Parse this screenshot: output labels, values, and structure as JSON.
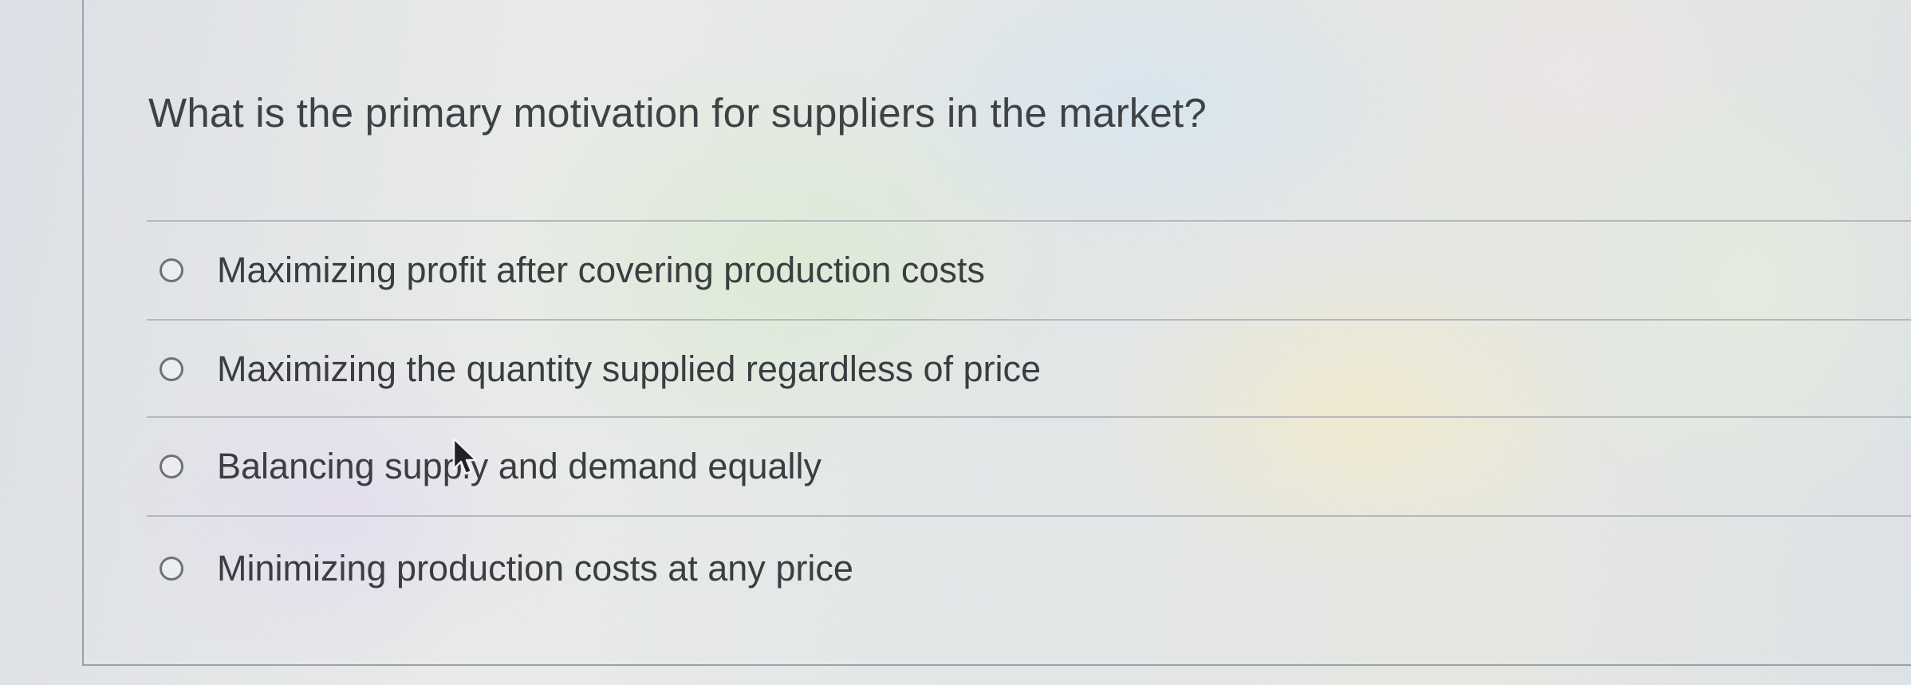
{
  "question": {
    "text": "What is the primary motivation for suppliers in the market?"
  },
  "options": [
    {
      "label": "Maximizing profit after covering production costs",
      "selected": false
    },
    {
      "label": "Maximizing the quantity supplied regardless of price",
      "selected": false
    },
    {
      "label": "Balancing supply and demand equally",
      "selected": false
    },
    {
      "label": "Minimizing production costs at any price",
      "selected": false
    }
  ],
  "colors": {
    "text": "#3b3e41",
    "divider": "#b4b8bd",
    "radio_border": "#6d7278"
  },
  "icons": {
    "pointer": "mouse-pointer-icon",
    "radio": "radio-unselected-icon"
  }
}
